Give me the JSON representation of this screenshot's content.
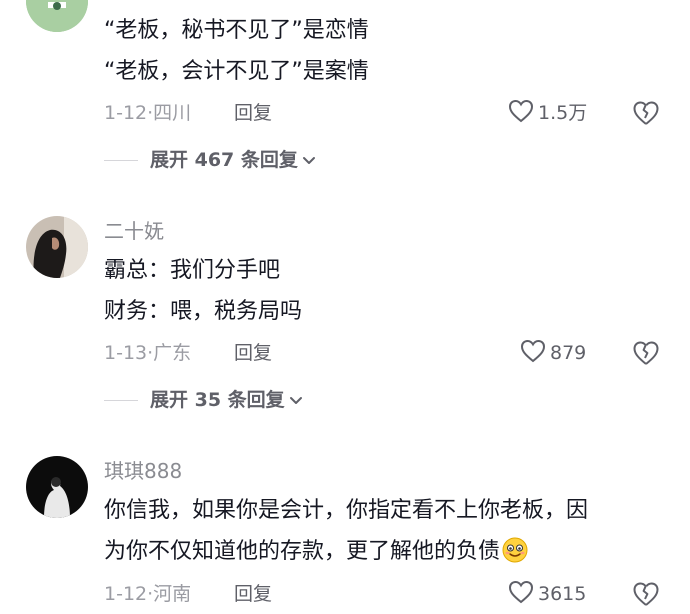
{
  "comments": [
    {
      "username": "",
      "lines": [
        "“老板，秘书不见了”是恋情",
        "“老板，会计不见了”是案情"
      ],
      "date": "1-12",
      "sep": "·",
      "location": "四川",
      "reply_label": "回复",
      "likes": "1.5万",
      "expand_label": "展开 467 条回复"
    },
    {
      "username": "二十妩",
      "lines": [
        "霸总：我们分手吧",
        "财务：喂，税务局吗"
      ],
      "date": "1-13",
      "sep": "·",
      "location": "广东",
      "reply_label": "回复",
      "likes": "879",
      "expand_label": "展开 35 条回复"
    },
    {
      "username": "琪琪888",
      "lines": [
        "你信我，如果你是会计，你指定看不上你老板，因",
        "为你不仅知道他的存款，更了解他的负债"
      ],
      "date": "1-12",
      "sep": "·",
      "location": "河南",
      "reply_label": "回复",
      "likes": "3615"
    }
  ],
  "icons": {
    "like": "heart-outline-icon",
    "dislike": "broken-heart-icon",
    "expand": "chevron-down-icon",
    "emoji": "smile-emoji-icon"
  },
  "colors": {
    "text": "#161823",
    "secondary": "#8a8b91",
    "action": "#5f6068"
  }
}
